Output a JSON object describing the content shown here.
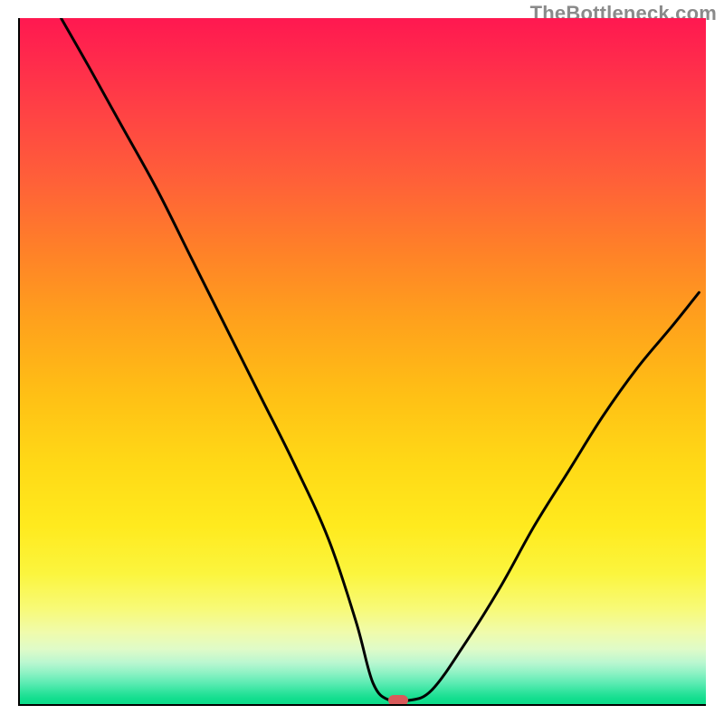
{
  "watermark": {
    "text": "TheBottleneck.com"
  },
  "colors": {
    "curve_stroke": "#000000",
    "marker_fill": "#d85a5a",
    "axis": "#000000"
  },
  "chart_data": {
    "type": "line",
    "title": "",
    "xlabel": "",
    "ylabel": "",
    "xlim": [
      0,
      100
    ],
    "ylim": [
      0,
      100
    ],
    "grid": false,
    "legend": false,
    "background_gradient": {
      "direction": "vertical",
      "stops": [
        {
          "pos": 0.0,
          "color": "#ff1850"
        },
        {
          "pos": 0.24,
          "color": "#ff6138"
        },
        {
          "pos": 0.55,
          "color": "#ffc015"
        },
        {
          "pos": 0.81,
          "color": "#fbf53e"
        },
        {
          "pos": 0.92,
          "color": "#dffbc8"
        },
        {
          "pos": 1.0,
          "color": "#0cdc89"
        }
      ]
    },
    "series": [
      {
        "name": "bottleneck-curve",
        "x": [
          6,
          10,
          15,
          20,
          25,
          30,
          35,
          40,
          45,
          49,
          51.5,
          54,
          56.5,
          60,
          65,
          70,
          75,
          80,
          85,
          90,
          95,
          99
        ],
        "y": [
          100,
          93,
          84,
          75,
          65,
          55,
          45,
          35,
          24,
          12,
          3,
          0.5,
          0.5,
          2,
          9,
          17,
          26,
          34,
          42,
          49,
          55,
          60
        ]
      }
    ],
    "markers": [
      {
        "name": "optimum-marker",
        "x": 55,
        "y": 0.8
      }
    ]
  }
}
